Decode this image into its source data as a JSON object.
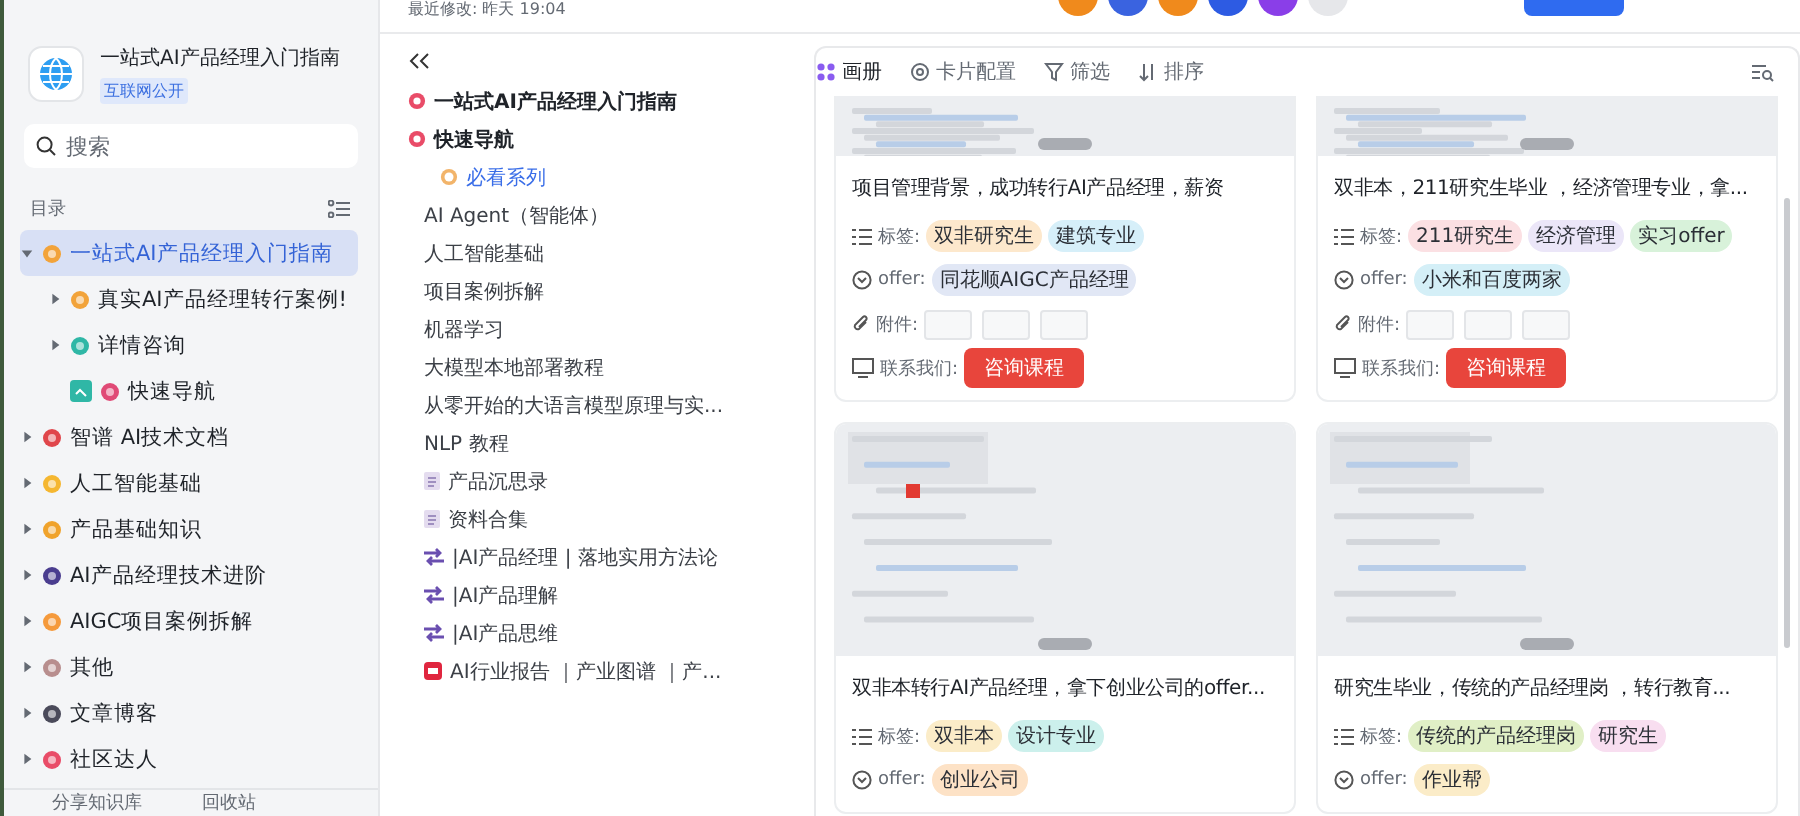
{
  "header": {
    "modified": "最近修改: 昨天 19:04",
    "avatars": [
      {
        "color": "#f08a1c"
      },
      {
        "color": "#3a63e0"
      },
      {
        "color": "#f08a1c"
      },
      {
        "color": "#2d5be3"
      },
      {
        "color": "#8a3ee8"
      },
      {
        "color": "#e6e7ea"
      }
    ]
  },
  "sidebar": {
    "title": "一站式AI产品经理入门指南",
    "badge": "互联网公开",
    "search": {
      "placeholder": "搜索"
    },
    "section": "目录",
    "tree": [
      {
        "label": "一站式AI产品经理入门指南",
        "selected": true,
        "expanded": true,
        "children": [
          {
            "label": "真实AI产品经理转行案例!",
            "selected": false,
            "expanded": false
          },
          {
            "label": "详情咨询",
            "selected": false,
            "expanded": false
          },
          {
            "label": "快速导航",
            "selected": false,
            "kind": "doc"
          }
        ]
      },
      {
        "label": "智谱 AI技术文档",
        "selected": false,
        "expanded": false
      },
      {
        "label": "人工智能基础",
        "selected": false,
        "expanded": false
      },
      {
        "label": "产品基础知识",
        "selected": false,
        "expanded": false
      },
      {
        "label": "AI产品经理技术进阶",
        "selected": false,
        "expanded": false
      },
      {
        "label": "AIGC项目案例拆解",
        "selected": false,
        "expanded": false
      },
      {
        "label": "其他",
        "selected": false,
        "expanded": false
      },
      {
        "label": "文章博客",
        "selected": false,
        "expanded": false
      },
      {
        "label": "社区达人",
        "selected": false,
        "expanded": false
      }
    ],
    "footer": [
      "分享知识库",
      "回收站"
    ]
  },
  "outline": [
    {
      "text": "一站式AI产品经理入门指南",
      "kind": "heading"
    },
    {
      "text": "快速导航",
      "kind": "heading",
      "children": [
        {
          "text": "必看系列",
          "kind": "compass",
          "selected": true
        },
        {
          "text": "AI Agent（智能体）",
          "kind": "plain",
          "selected": false
        },
        {
          "text": "人工智能基础",
          "kind": "plain",
          "selected": false
        },
        {
          "text": "项目案例拆解",
          "kind": "plain",
          "selected": false
        },
        {
          "text": "机器学习",
          "kind": "plain",
          "selected": false
        },
        {
          "text": "大模型本地部署教程",
          "kind": "plain",
          "selected": false
        },
        {
          "text": "从零开始的大语言模型原理与实...",
          "kind": "plain",
          "selected": false
        },
        {
          "text": "NLP 教程",
          "kind": "plain",
          "selected": false
        },
        {
          "text": "产品沉思录",
          "kind": "doc",
          "selected": false
        },
        {
          "text": "资料合集",
          "kind": "doc",
          "selected": false
        },
        {
          "text": "|AI产品经理 | 落地实用方法论",
          "kind": "link",
          "selected": false
        },
        {
          "text": "|AI产品理解",
          "kind": "link",
          "selected": false
        },
        {
          "text": "|AI产品思维",
          "kind": "link",
          "selected": false
        },
        {
          "text": "AI行业报告 ｜产业图谱 ｜产...",
          "kind": "report",
          "selected": false
        }
      ]
    }
  ],
  "gallery": {
    "views": [
      {
        "label": "画册",
        "selected": true
      },
      {
        "label": "卡片配置",
        "selected": false
      },
      {
        "label": "筛选",
        "selected": false
      },
      {
        "label": "排序",
        "selected": false
      }
    ],
    "cards": [
      {
        "title": "项目管理背景，成功转行AI产品经理，薪资",
        "tags_label": "标签:",
        "tags": [
          {
            "text": "双非研究生",
            "color": "#fde8cc"
          },
          {
            "text": "建筑专业",
            "color": "#d6eff9"
          }
        ],
        "offer_label": "offer:",
        "offer": [
          {
            "text": "同花顺AIGC产品经理",
            "color": "#e1e7f5"
          }
        ],
        "attachments_label": "附件:",
        "contact_label": "联系我们:",
        "contact_button": "咨询课程"
      },
      {
        "title": "双非本，211研究生毕业 ，经济管理专业，拿...",
        "tags_label": "标签:",
        "tags": [
          {
            "text": "211研究生",
            "color": "#fbe0e3"
          },
          {
            "text": "经济管理",
            "color": "#ebe6f8"
          },
          {
            "text": "实习offer",
            "color": "#d8f2da"
          }
        ],
        "offer_label": "offer:",
        "offer": [
          {
            "text": "小米和百度两家",
            "color": "#d4eff7"
          }
        ],
        "attachments_label": "附件:",
        "contact_label": "联系我们:",
        "contact_button": "咨询课程"
      },
      {
        "title": "双非本转行AI产品经理，拿下创业公司的offer...",
        "tags_label": "标签:",
        "tags": [
          {
            "text": "双非本",
            "color": "#fbecc8"
          },
          {
            "text": "设计专业",
            "color": "#ccf0ec"
          }
        ],
        "offer_label": "offer:",
        "offer": [
          {
            "text": "创业公司",
            "color": "#fde2c6"
          }
        ]
      },
      {
        "title": "研究生毕业，传统的产品经理岗 ，转行教育...",
        "tags_label": "标签:",
        "tags": [
          {
            "text": "传统的产品经理岗",
            "color": "#e0efc6"
          },
          {
            "text": "研究生",
            "color": "#f8def0"
          }
        ],
        "offer_label": "offer:",
        "offer": [
          {
            "text": "作业帮",
            "color": "#fbecc8"
          }
        ]
      }
    ]
  }
}
